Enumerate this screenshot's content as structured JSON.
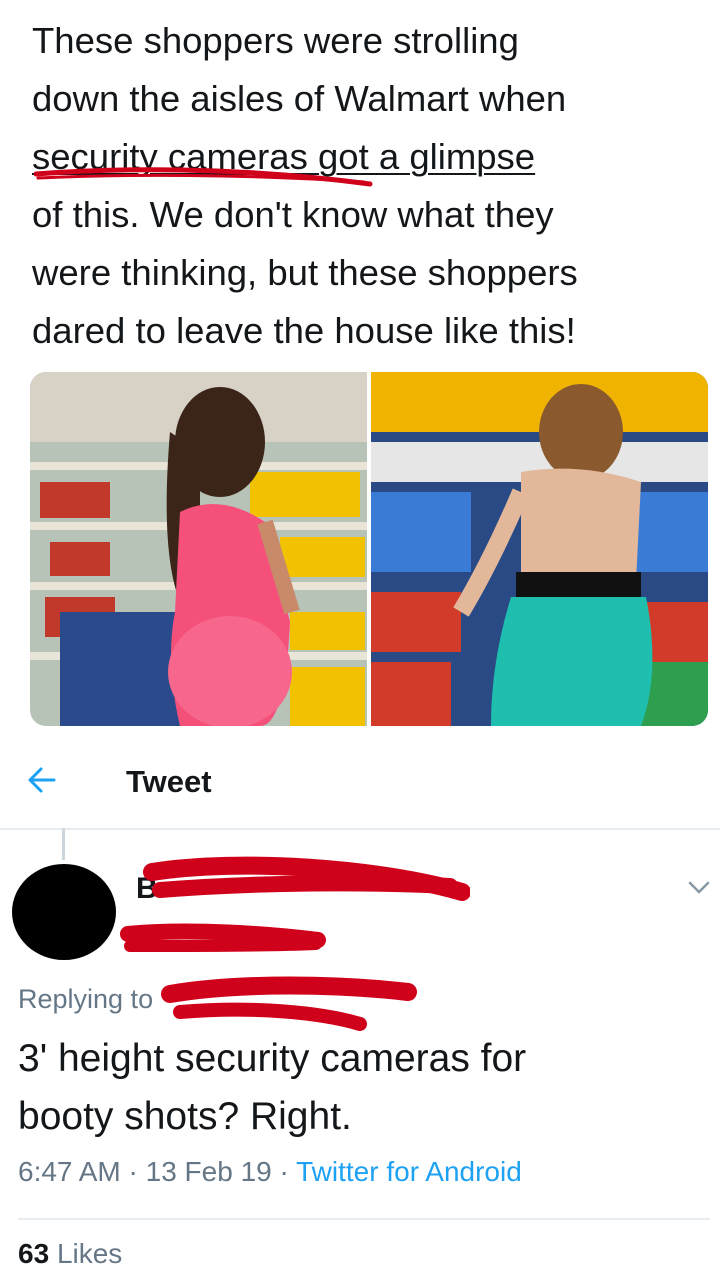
{
  "quoted_tweet": {
    "lines": [
      "These shoppers were strolling",
      "down the aisles of Walmart when",
      "security cameras got a glimpse",
      "of this. We don't know what they",
      "were thinking, but these shoppers",
      "dared to leave the house like this!"
    ]
  },
  "nav": {
    "title": "Tweet"
  },
  "reply": {
    "replying_to_label": "Replying to",
    "text_lines": [
      "3' height security cameras for",
      "booty shots? Right."
    ],
    "time": "6:47 AM",
    "separator": " · ",
    "date": "13 Feb 19",
    "source": "Twitter for Android",
    "likes_count": "63",
    "likes_label": "Likes"
  },
  "colors": {
    "accent": "#1da1f2",
    "redaction": "#d0021b",
    "text": "#14171a",
    "muted": "#657786"
  }
}
